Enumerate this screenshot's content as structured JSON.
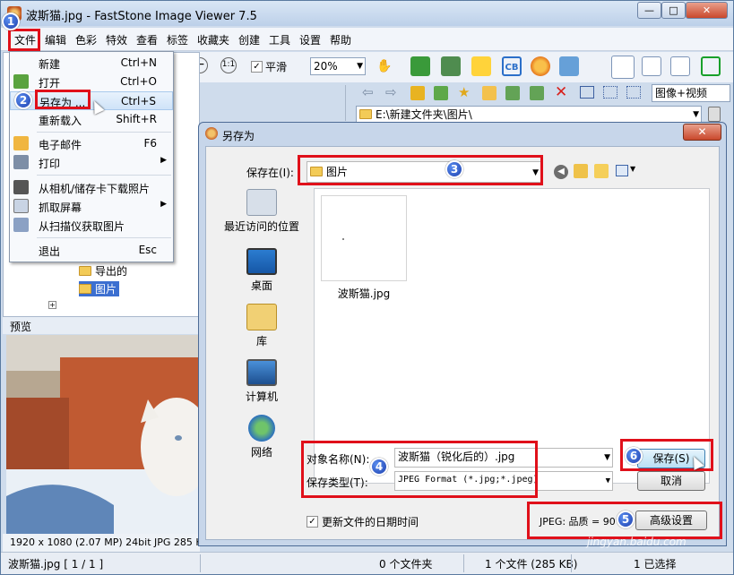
{
  "window": {
    "title": "波斯猫.jpg  -  FastStone Image Viewer 7.5",
    "buttons": {
      "minimize": "—",
      "maximize": "□",
      "close": "✕"
    }
  },
  "menu": {
    "items": [
      "文件",
      "编辑",
      "色彩",
      "特效",
      "查看",
      "标签",
      "收藏夹",
      "创建",
      "工具",
      "设置",
      "帮助"
    ]
  },
  "toolbar": {
    "smooth_label": "平滑",
    "zoom_value": "20%",
    "view_mode": "图像+视频"
  },
  "address": {
    "path": "E:\\新建文件夹\\图片\\"
  },
  "file_menu": {
    "items": [
      {
        "label": "新建",
        "shortcut": "Ctrl+N"
      },
      {
        "label": "打开",
        "shortcut": "Ctrl+O"
      },
      {
        "label": "另存为 ...",
        "shortcut": "Ctrl+S"
      },
      {
        "label": "重新载入",
        "shortcut": "Shift+R"
      },
      {
        "label": "电子邮件",
        "shortcut": "F6"
      },
      {
        "label": "打印",
        "shortcut": ""
      },
      {
        "label": "从相机/储存卡下载照片",
        "shortcut": ""
      },
      {
        "label": "抓取屏幕",
        "shortcut": ""
      },
      {
        "label": "从扫描仪获取图片",
        "shortcut": ""
      },
      {
        "label": "退出",
        "shortcut": "Esc"
      }
    ]
  },
  "tree": {
    "items": [
      "导出的",
      "图片"
    ]
  },
  "preview": {
    "label": "预览",
    "info": "1920 x 1080 (2.07 MP)  24bit  JPG  285 KB"
  },
  "dialog": {
    "title": "另存为",
    "close": "✕",
    "save_in_label": "保存在(I):",
    "save_in_value": "图片",
    "places": [
      "最近访问的位置",
      "桌面",
      "库",
      "计算机",
      "网络"
    ],
    "file": {
      "name": "波斯猫.jpg"
    },
    "filename_label": "对象名称(N):",
    "filename_value": "波斯猫（锐化后的）.jpg",
    "filetype_label": "保存类型(T):",
    "filetype_value": "JPEG Format (*.jpg;*.jpeg)",
    "save_button": "保存(S)",
    "cancel_button": "取消",
    "update_date_label": "更新文件的日期时间",
    "jpeg_quality": "JPEG: 品质 = 90",
    "advanced_button": "高级设置"
  },
  "status": {
    "file": "波斯猫.jpg [ 1 / 1 ]",
    "folders": "0 个文件夹",
    "files": "1 个文件 (285 KB)",
    "selected": "1 已选择"
  },
  "steps": [
    "1",
    "2",
    "3",
    "4",
    "5",
    "6"
  ],
  "colors": {
    "highlight": "#e0101a",
    "badge": "#1d3fae"
  },
  "watermark": "jingyan.baidu.com"
}
